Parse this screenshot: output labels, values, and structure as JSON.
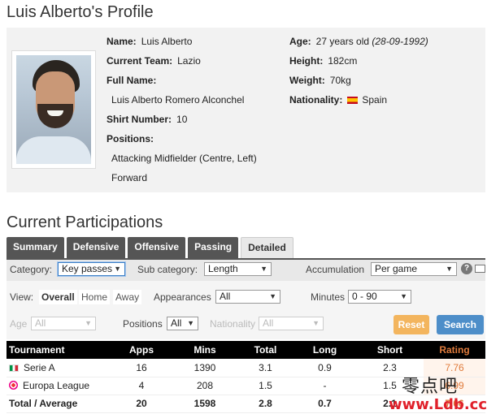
{
  "profile": {
    "title": "Luis Alberto's Profile",
    "name_label": "Name:",
    "name": "Luis Alberto",
    "team_label": "Current Team:",
    "team": "Lazio",
    "full_name_label": "Full Name:",
    "full_name": "Luis Alberto Romero Alconchel",
    "shirt_label": "Shirt Number:",
    "shirt": "10",
    "positions_label": "Positions:",
    "positions": [
      "Attacking Midfielder (Centre, Left)",
      "Forward"
    ],
    "age_label": "Age:",
    "age": "27 years old",
    "dob": "(28-09-1992)",
    "height_label": "Height:",
    "height": "182cm",
    "weight_label": "Weight:",
    "weight": "70kg",
    "nationality_label": "Nationality:",
    "nationality": "Spain"
  },
  "participations": {
    "title": "Current Participations",
    "tabs": [
      "Summary",
      "Defensive",
      "Offensive",
      "Passing",
      "Detailed"
    ],
    "active_tab": "Detailed"
  },
  "filters": {
    "category_label": "Category:",
    "category": "Key passes",
    "subcategory_label": "Sub category:",
    "subcategory": "Length",
    "accumulation_label": "Accumulation",
    "accumulation": "Per game",
    "view_label": "View:",
    "view_options": [
      "Overall",
      "Home",
      "Away"
    ],
    "view_selected": "Overall",
    "appearances_label": "Appearances",
    "appearances": "All",
    "minutes_label": "Minutes",
    "minutes": "0 - 90",
    "age_label": "Age",
    "age": "All",
    "positions_label": "Positions",
    "positions": "All",
    "nationality_label": "Nationality",
    "nationality": "All",
    "reset_label": "Reset",
    "search_label": "Search",
    "help_glyph": "?"
  },
  "table": {
    "headers": [
      "Tournament",
      "Apps",
      "Mins",
      "Total",
      "Long",
      "Short",
      "Rating"
    ],
    "rows": [
      {
        "tournament": "Serie A",
        "icon": "italy-flag-icon",
        "apps": "16",
        "mins": "1390",
        "total": "3.1",
        "long": "0.9",
        "short": "2.3",
        "rating": "7.76"
      },
      {
        "tournament": "Europa League",
        "icon": "europa-league-icon",
        "apps": "4",
        "mins": "208",
        "total": "1.5",
        "long": "-",
        "short": "1.5",
        "rating": "6.99"
      }
    ],
    "total": {
      "label": "Total / Average",
      "apps": "20",
      "mins": "1598",
      "total": "2.8",
      "long": "0.7",
      "short": "2.1",
      "rating": "7.66"
    }
  },
  "watermark": {
    "chinese": "零点吧",
    "url": "www.Ldb.cc"
  },
  "colors": {
    "rating": "#e07b3c",
    "reset": "#f3b55e",
    "search": "#4d8ec9",
    "tab_bg": "#555555"
  }
}
